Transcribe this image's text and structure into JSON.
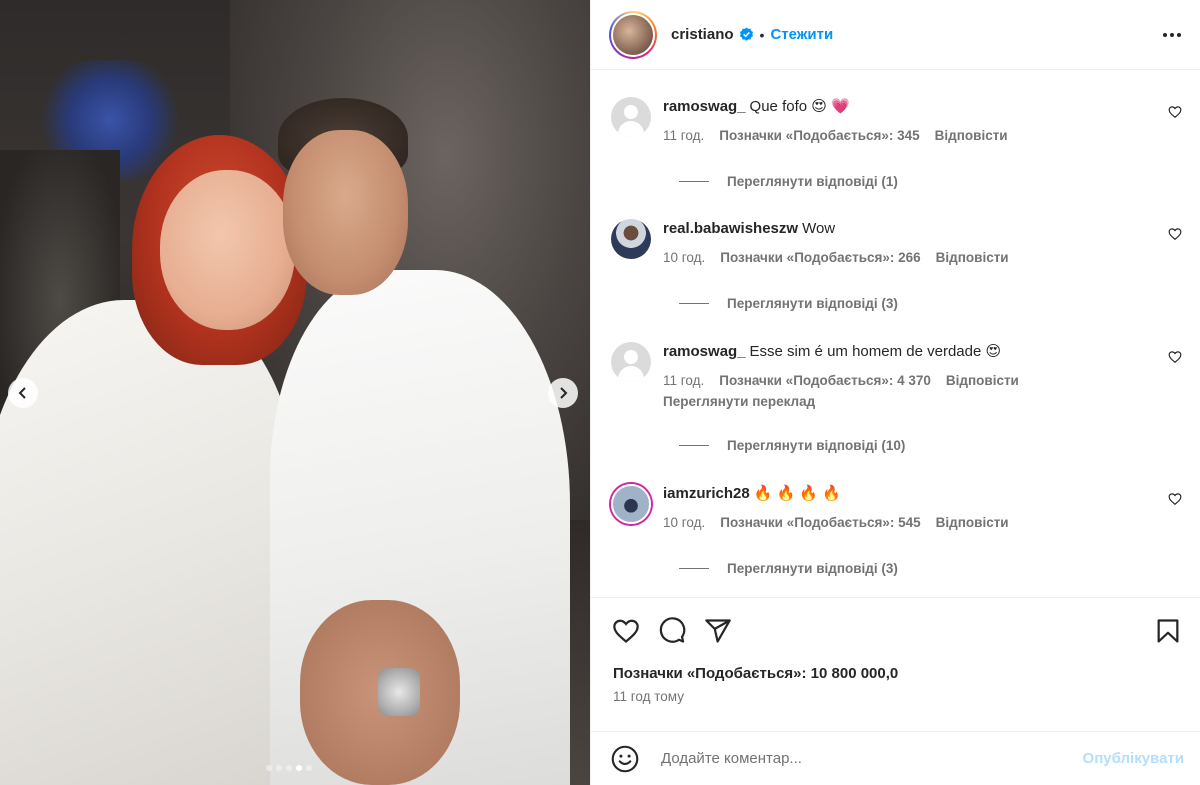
{
  "post": {
    "username": "cristiano",
    "separator": "•",
    "follow_label": "Стежити",
    "carousel": {
      "slides": 5,
      "active_slide": 4
    }
  },
  "comments": [
    {
      "user": "ramoswag_",
      "text": "Que fofo 😍 💗",
      "time": "11 год.",
      "likes": "Позначки «Подобається»: 345",
      "reply": "Відповісти",
      "view_replies": "Переглянути відповіді (1)",
      "avatar": "default-avatar-icon"
    },
    {
      "user": "real.babawisheszw",
      "text": "Wow",
      "time": "10 год.",
      "likes": "Позначки «Подобається»: 266",
      "reply": "Відповісти",
      "view_replies": "Переглянути відповіді (3)",
      "avatar": "photo"
    },
    {
      "user": "ramoswag_",
      "text": "Esse sim é um homem de verdade 😍",
      "time": "11 год.",
      "likes": "Позначки «Подобається»: 4 370",
      "reply": "Відповісти",
      "translate": "Переглянути переклад",
      "view_replies": "Переглянути відповіді (10)",
      "avatar": "default-avatar-icon"
    },
    {
      "user": "iamzurich28",
      "text": "🔥 🔥 🔥 🔥",
      "time": "10 год.",
      "likes": "Позначки «Подобається»: 545",
      "reply": "Відповісти",
      "view_replies": "Переглянути відповіді (3)",
      "avatar": "photo-with-story-ring"
    }
  ],
  "actions": {
    "likes_total": "Позначки «Подобається»: 10 800 000,0",
    "time_ago": "11 год тому"
  },
  "add_comment": {
    "placeholder": "Додайте коментар...",
    "publish_label": "Опублікувати"
  },
  "colors": {
    "accent": "#0095f6",
    "publish_disabled": "#b2dffc",
    "muted_text": "#737373",
    "text": "#262626",
    "border": "#efefef"
  }
}
